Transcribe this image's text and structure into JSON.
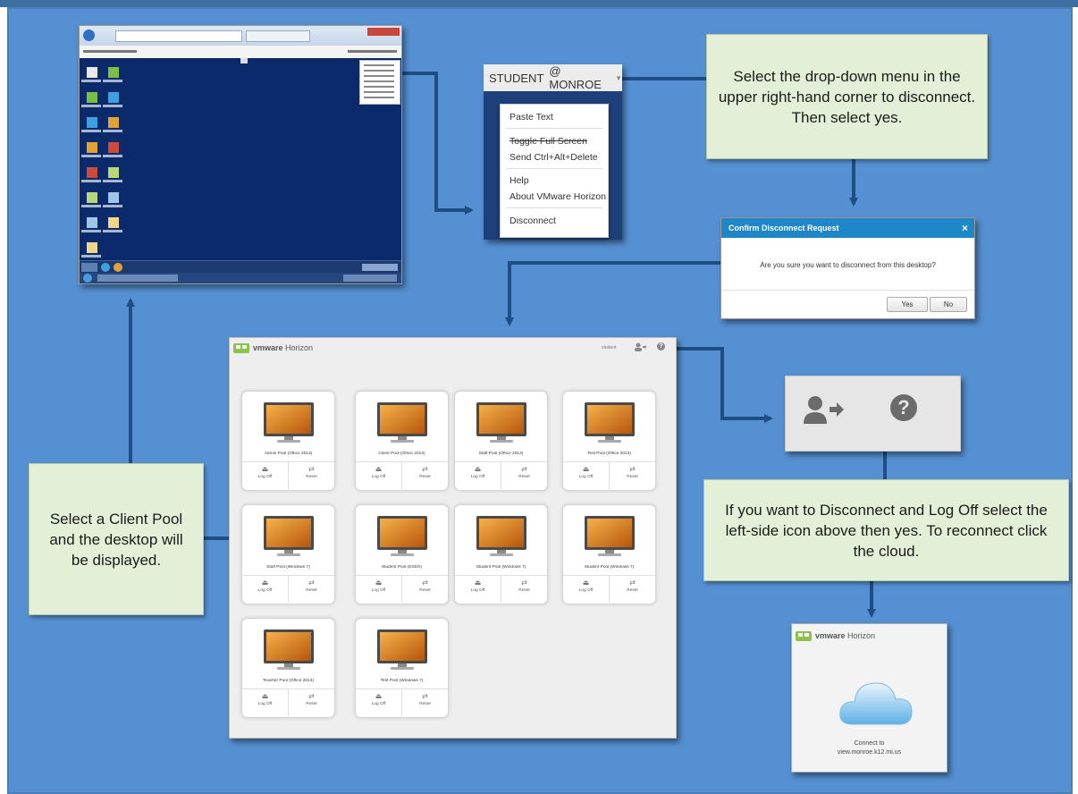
{
  "notes": {
    "disconnect_menu": "Select the drop-down menu in the upper right-hand corner to disconnect. Then select yes.",
    "client_pool": "Select a Client Pool and the desktop will be displayed.",
    "logoff": "If you want to Disconnect and Log Off select the left-side icon above then yes. To reconnect click the cloud."
  },
  "student_menu": {
    "user": "STUDENT",
    "domain": "@ MONROE",
    "items": [
      "Paste Text",
      "Toggle Full Screen",
      "Send Ctrl+Alt+Delete",
      "Help",
      "About VMware Horizon",
      "Disconnect"
    ]
  },
  "dialog": {
    "title": "Confirm Disconnect Request",
    "close": "×",
    "message": "Are you sure you want to disconnect from this desktop?",
    "yes": "Yes",
    "no": "No"
  },
  "horizon": {
    "brand": "vmware",
    "product": "Horizon",
    "user": "student",
    "pools": [
      {
        "name": "Admin Pool (Office 2013)",
        "a1": "Log Off",
        "a2": "Reset"
      },
      {
        "name": "Client Pool (Office 2013)",
        "a1": "Log Off",
        "a2": "Reset"
      },
      {
        "name": "Staff Pool (Office 2013)",
        "a1": "Log Off",
        "a2": "Reset"
      },
      {
        "name": "Test Pool (Office 2013)",
        "a1": "Log Off",
        "a2": "Reset"
      },
      {
        "name": "Staff Pool (Windows 7)",
        "a1": "Log Off",
        "a2": "Reset"
      },
      {
        "name": "Student Pool (ESDS)",
        "a1": "Log Off",
        "a2": "Reset"
      },
      {
        "name": "Student Pool (Windows 7)",
        "a1": "Log Off",
        "a2": "Reset"
      },
      {
        "name": "Student Pool (Windows 7)",
        "a1": "Log Off",
        "a2": "Reset"
      },
      {
        "name": "Teacher Pool (Office 2013)",
        "a1": "Log Off",
        "a2": "Reset"
      },
      {
        "name": "Test Pool (Windows 7)",
        "a1": "Log Off",
        "a2": "Reset"
      }
    ]
  },
  "connect_panel": {
    "brand": "vmware",
    "product": "Horizon",
    "line1": "Connect to",
    "line2": "view.monroe.k12.mi.us"
  },
  "icons": {
    "logoff": "logoff-user-icon",
    "help": "help-question-icon",
    "cloud": "cloud-icon"
  }
}
